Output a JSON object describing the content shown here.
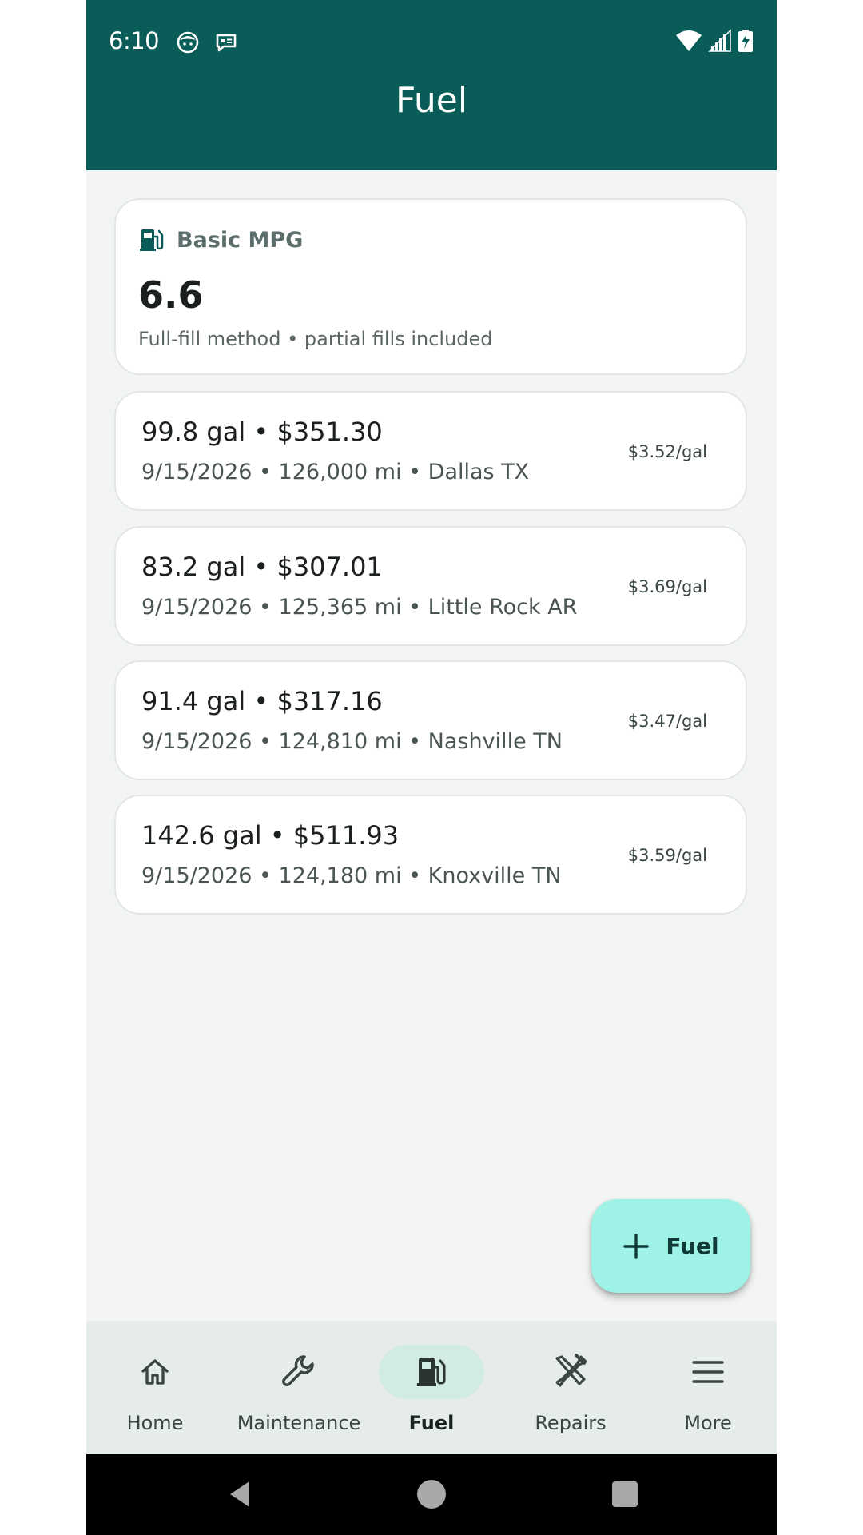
{
  "colors": {
    "app_bar": "#095c57",
    "background": "#f3f5f4",
    "fab": "#9ff2e6",
    "nav_bar": "#e6ecea",
    "nav_active_pill": "#d3ebe5"
  },
  "status_bar": {
    "time": "6:10",
    "left_icons": [
      "face-icon",
      "message-icon"
    ],
    "right_icons": [
      "wifi-icon",
      "signal-icon",
      "battery-charging-icon"
    ]
  },
  "app_bar": {
    "title": "Fuel"
  },
  "summary": {
    "icon": "fuel-pump-icon",
    "label": "Basic MPG",
    "value": "6.6",
    "note": "Full-fill method • partial fills included"
  },
  "entries": [
    {
      "main": "99.8 gal • $351.30",
      "sub": "9/15/2026 • 126,000 mi • Dallas TX",
      "price_per_gal": "$3.52/gal"
    },
    {
      "main": "83.2 gal • $307.01",
      "sub": "9/15/2026 • 125,365 mi • Little Rock AR",
      "price_per_gal": "$3.69/gal"
    },
    {
      "main": "91.4 gal • $317.16",
      "sub": "9/15/2026 • 124,810 mi • Nashville TN",
      "price_per_gal": "$3.47/gal"
    },
    {
      "main": "142.6 gal • $511.93",
      "sub": "9/15/2026 • 124,180 mi • Knoxville TN",
      "price_per_gal": "$3.59/gal"
    }
  ],
  "fab": {
    "icon": "plus-icon",
    "label": "Fuel"
  },
  "bottom_nav": {
    "items": [
      {
        "label": "Home",
        "icon": "home-icon",
        "active": false
      },
      {
        "label": "Maintenance",
        "icon": "wrench-icon",
        "active": false
      },
      {
        "label": "Fuel",
        "icon": "fuel-pump-icon",
        "active": true
      },
      {
        "label": "Repairs",
        "icon": "tools-icon",
        "active": false
      },
      {
        "label": "More",
        "icon": "menu-icon",
        "active": false
      }
    ]
  },
  "system_nav": {
    "buttons": [
      "back-icon",
      "home-circle-icon",
      "recents-icon"
    ]
  }
}
